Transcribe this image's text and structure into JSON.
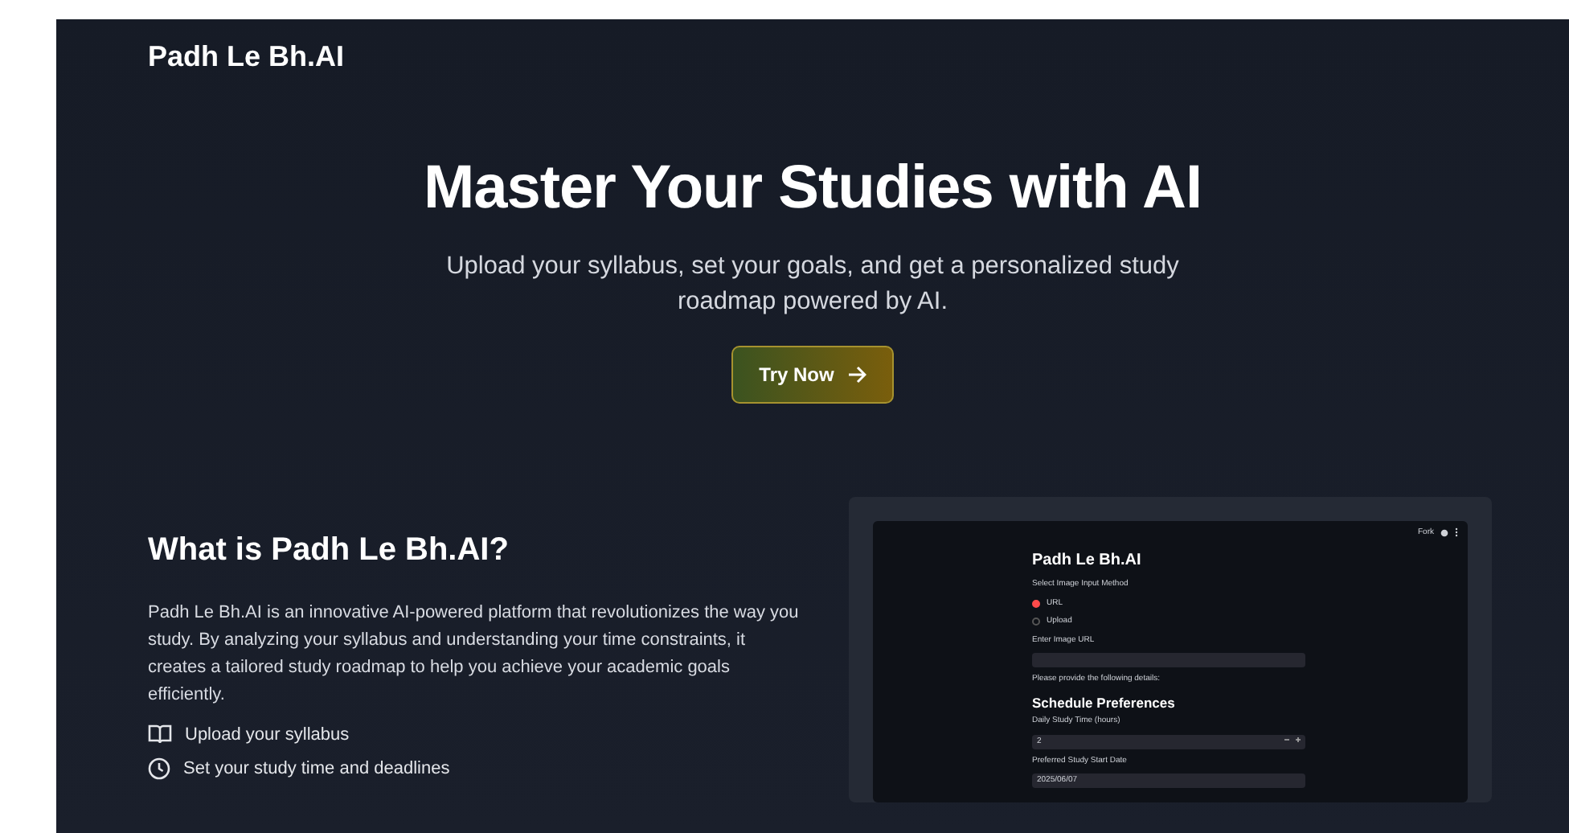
{
  "navbar": {
    "brand": "Padh Le Bh.AI"
  },
  "hero": {
    "title": "Master Your Studies with AI",
    "subtitle": "Upload your syllabus, set your goals, and get a personalized study roadmap powered by AI.",
    "button": "Try Now"
  },
  "about": {
    "heading": "What is Padh Le Bh.AI?",
    "text": "Padh Le Bh.AI is an innovative AI-powered platform that revolutionizes the way you study. By analyzing your syllabus and understanding your time constraints, it creates a tailored study roadmap to help you achieve your academic goals efficiently.",
    "features": [
      {
        "kind": "book",
        "label": "Upload your syllabus"
      },
      {
        "kind": "clock",
        "label": "Set your study time and deadlines"
      }
    ]
  },
  "preview": {
    "toolbar": "Fork",
    "title": "Padh Le Bh.AI",
    "method_label": "Select Image Input Method",
    "options": [
      {
        "label": "URL",
        "selected": true
      },
      {
        "label": "Upload",
        "selected": false
      }
    ],
    "url_label": "Enter Image URL",
    "note": "Please provide the following details:",
    "section": "Schedule Preferences",
    "hours_label": "Daily Study Time (hours)",
    "hours_value": "2",
    "date_label": "Preferred Study Start Date",
    "date_value": "2025/06/07"
  }
}
